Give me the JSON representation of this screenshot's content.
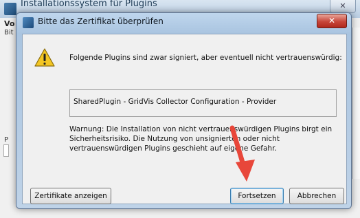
{
  "background_window": {
    "title": "Installationssystem für Plugins",
    "close_glyph": "✕",
    "fragment_heading": "Vo",
    "fragment_sub": "Bit",
    "fragment_left": "P"
  },
  "dialog": {
    "title": "Bitte das Zertifikat überprüfen",
    "close_glyph": "✕",
    "message": "Folgende Plugins sind zwar signiert, aber eventuell nicht vertrauenswürdig:",
    "plugin": "SharedPlugin - GridVis Collector Configuration - Provider",
    "warning": "Warnung: Die Installation von nicht vertrauenswürdigen Plugins birgt ein Sicherheitsrisiko.  Die Nutzung von unsignierten oder nicht vertrauenswürdigen Plugins geschieht auf eigene Gefahr.",
    "buttons": {
      "show_certs": "Zertifikate anzeigen",
      "continue": "Fortsetzen",
      "cancel": "Abbrechen"
    }
  },
  "colors": {
    "annotation_arrow": "#e8473a",
    "warning_icon": "#f3c623"
  }
}
